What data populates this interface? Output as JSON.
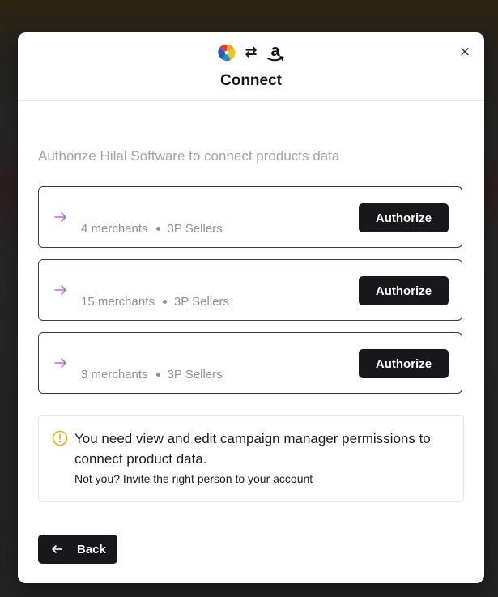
{
  "modal": {
    "title": "Connect",
    "close_label": "×",
    "swap_symbol": "⇄",
    "logos": {
      "left": "partner-app-logo",
      "right": "amazon-logo"
    }
  },
  "subtitle": "Authorize Hilal Software to connect products data",
  "accounts": [
    {
      "merchants": "4 merchants",
      "type": "3P Sellers",
      "button": "Authorize"
    },
    {
      "merchants": "15 merchants",
      "type": "3P Sellers",
      "button": "Authorize"
    },
    {
      "merchants": "3 merchants",
      "type": "3P Sellers",
      "button": "Authorize"
    }
  ],
  "notice": {
    "text": "You need view and edit campaign manager permissions to connect product data.",
    "link": "Not you? Invite the right person to your account"
  },
  "back_button": {
    "label": "Back"
  },
  "colors": {
    "primary_button": "#18181b",
    "arrow_accent": "#b46be0",
    "warning": "#e7b21a",
    "card_border": "#3a3850"
  }
}
